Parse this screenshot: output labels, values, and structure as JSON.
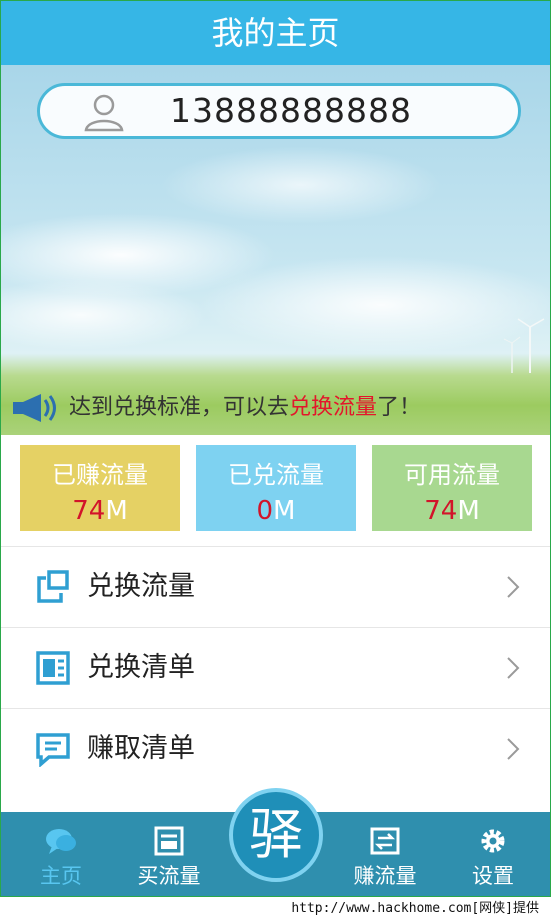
{
  "header": {
    "title": "我的主页"
  },
  "account": {
    "phone": "13888888888"
  },
  "notice": {
    "prefix": "达到兑换标准，可以去",
    "highlight": "兑换流量",
    "suffix": "了！"
  },
  "stats": [
    {
      "label": "已赚流量",
      "value": "74",
      "unit": "M",
      "color": "#e5d164"
    },
    {
      "label": "已兑流量",
      "value": "0",
      "unit": "M",
      "color": "#7ed2f1"
    },
    {
      "label": "可用流量",
      "value": "74",
      "unit": "M",
      "color": "#a8d890"
    }
  ],
  "menu": [
    {
      "label": "兑换流量",
      "icon": "exchange-icon"
    },
    {
      "label": "兑换清单",
      "icon": "list-icon"
    },
    {
      "label": "赚取清单",
      "icon": "message-icon"
    }
  ],
  "tabbar": {
    "home": "主页",
    "buy": "买流量",
    "center": "驿",
    "earn": "赚流量",
    "settings": "设置"
  },
  "watermark": "http://www.hackhome.com[网侠]提供",
  "colors": {
    "primary": "#36b6e6",
    "tabbar": "#2f8fae",
    "highlight": "#e3162b"
  }
}
